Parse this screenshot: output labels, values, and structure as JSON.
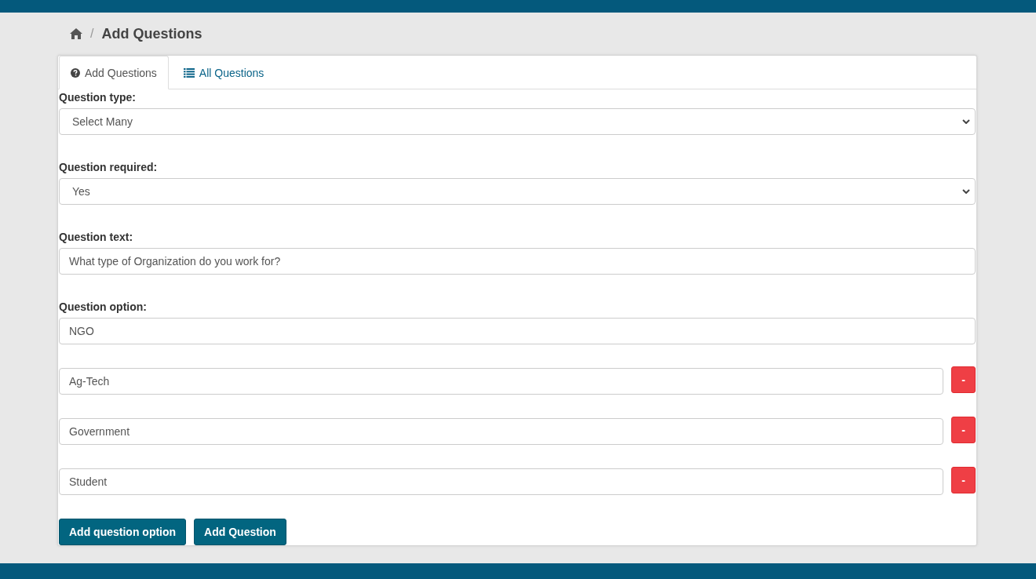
{
  "breadcrumb": {
    "separator": "/",
    "title": "Add Questions"
  },
  "tabs": [
    {
      "label": "Add Questions",
      "kind": "add",
      "selected": true
    },
    {
      "label": "All Questions",
      "kind": "list",
      "selected": false
    }
  ],
  "fields": [
    {
      "kind": "select",
      "label": "Question type:",
      "value": "Select Many"
    },
    {
      "kind": "select",
      "label": "Question required:",
      "value": "Yes"
    },
    {
      "kind": "text",
      "label": "Question text:",
      "value": "What type of Organization do you work for?"
    }
  ],
  "question_option": {
    "label": "Question option:",
    "options": [
      {
        "value": "NGO"
      },
      {
        "value": "Ag-Tech",
        "remove_button": "-"
      },
      {
        "value": "Government",
        "remove_button": "-"
      },
      {
        "value": "Student",
        "remove_button": "-"
      }
    ]
  },
  "buttons": [
    "Add question option",
    "Add Question"
  ]
}
